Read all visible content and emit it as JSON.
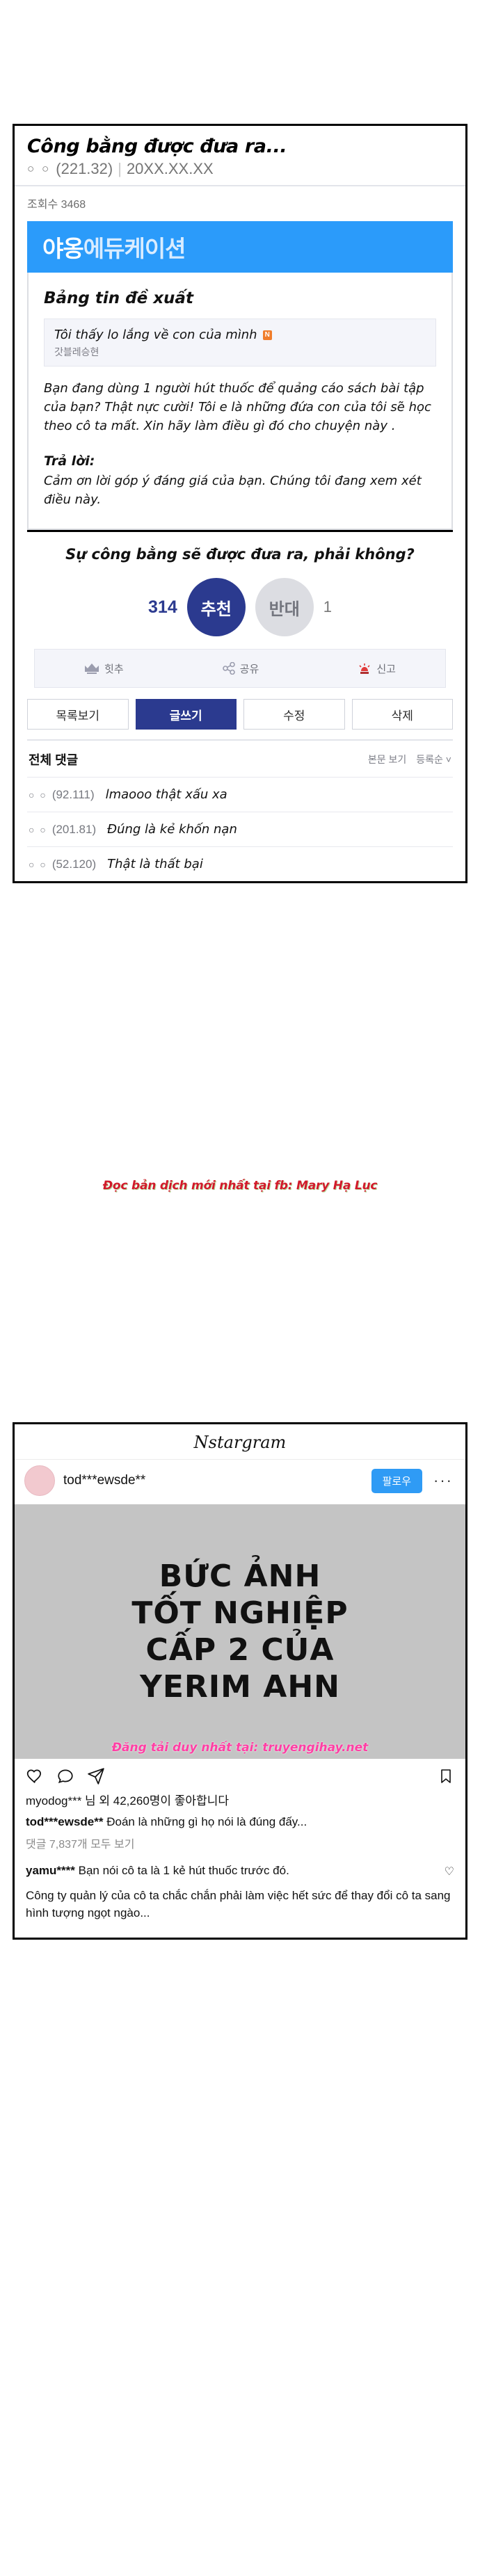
{
  "forum": {
    "title": "Công bằng được đưa ra...",
    "meta_dots": "○ ○",
    "meta_ip": "(221.32)",
    "meta_sep": "|",
    "meta_date": "20XX.XX.XX",
    "views_label": "조회수 3468",
    "banner_bold": "야옹",
    "banner_soft": "에듀케이션",
    "article_heading": "Bảng tin đề xuất",
    "quote_title": "Tôi thấy lo lắng về con của mình",
    "quote_badge": "N",
    "quote_author": "갓블레승현",
    "body_text": "Bạn đang dùng 1 người hút thuốc để quảng cáo sách bài tập của bạn? Thật nực cười! Tôi e là những đứa con của tôi sẽ học theo cô ta mất. Xin hãy làm điều gì đó cho chuyện này .",
    "reply_label": "Trả lời:",
    "reply_text": "Cảm ơn lời góp ý đáng giá của bạn. Chúng tôi đang xem xét điều này.",
    "question": "Sự công bằng sẽ được đưa ra, phải không?",
    "vote": {
      "up_count": "314",
      "up_label": "추천",
      "down_label": "반대",
      "down_count": "1"
    },
    "share_bar": [
      {
        "icon": "crown-icon",
        "label": "힛추"
      },
      {
        "icon": "share-icon",
        "label": "공유"
      },
      {
        "icon": "siren-icon",
        "label": "신고"
      }
    ],
    "buttons_row1": [
      {
        "label": "목록보기",
        "primary": false
      },
      {
        "label": "글쓰기",
        "primary": true
      },
      {
        "label": "수정",
        "primary": false
      },
      {
        "label": "삭제",
        "primary": false
      }
    ],
    "comments_header": {
      "left": "전체 댓글",
      "right": [
        "본문 보기",
        "등록순 ˅"
      ]
    },
    "comments": [
      {
        "dots": "○ ○",
        "ip": "(92.111)",
        "text": "lmaooo thật xấu xa"
      },
      {
        "dots": "○ ○",
        "ip": "(201.81)",
        "text": "Đúng là kẻ khốn nạn"
      },
      {
        "dots": "○ ○",
        "ip": "(52.120)",
        "text": "Thật là thất bại"
      }
    ],
    "watermark": "Đọc bản dịch mới nhất tại fb: Mary Hạ Lục"
  },
  "instagram": {
    "brand": "Nstargram",
    "username": "tod***ewsde**",
    "follow_label": "팔로우",
    "more_icon": "···",
    "photo_lines": [
      "BỨC ẢNH",
      "TỐT NGHIỆP",
      "CẤP 2 CỦA",
      "YERIM AHN"
    ],
    "photo_watermark": "Đăng tải duy nhất tại: truyengihay.net",
    "actions": [
      "heart-icon",
      "comment-icon",
      "send-icon",
      "bookmark-icon"
    ],
    "likes": "myodog*** 님 외 42,260명이 좋아합니다",
    "caption_user": "tod***ewsde**",
    "caption_text": "Đoán là những gì họ nói là đúng đấy...",
    "view_all": "댓글 7,837개 모두 보기",
    "comment_user": "yamu****",
    "comment_text": "Bạn nói cô ta là 1 kẻ hút thuốc trước đó.",
    "comment_body": "Công ty quản lý của cô ta chắc chắn phải làm việc hết sức để thay đổi cô ta sang hình tượng ngọt ngào..."
  }
}
